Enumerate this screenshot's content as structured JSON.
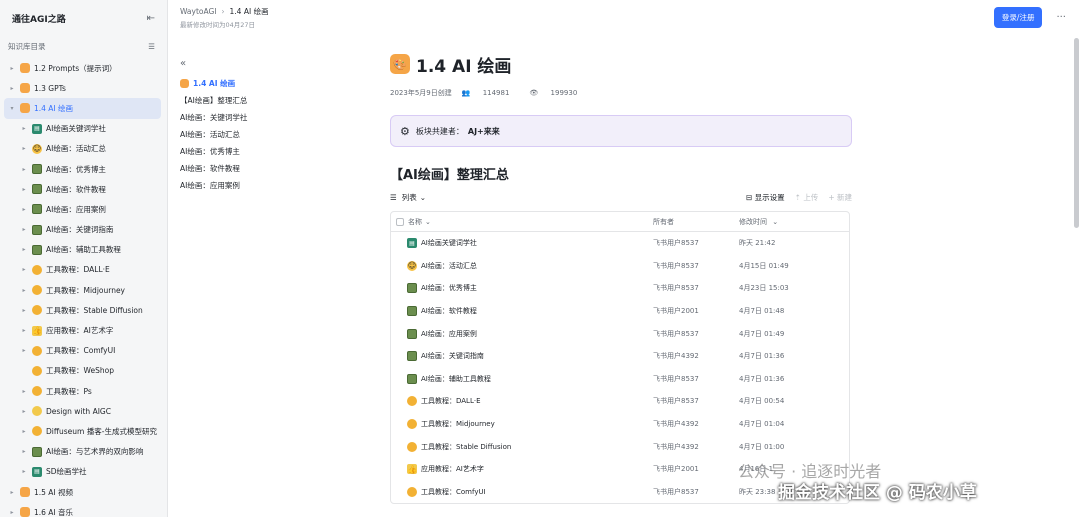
{
  "sidebar": {
    "title": "通往AGI之路",
    "section": "知识库目录",
    "items": [
      {
        "label": "1.2 Prompts（提示词）",
        "icon": "folder-icon",
        "level": 0
      },
      {
        "label": "1.3 GPTs",
        "icon": "folder-icon",
        "level": 0
      },
      {
        "label": "1.4 AI 绘画",
        "icon": "folder-icon",
        "level": 0,
        "active": true
      },
      {
        "label": "AI绘画关键词学社",
        "icon": "book-icon",
        "level": 1
      },
      {
        "label": "AI绘画：活动汇总",
        "icon": "face-icon",
        "level": 1
      },
      {
        "label": "AI绘画：优秀博主",
        "icon": "image-icon",
        "level": 1
      },
      {
        "label": "AI绘画：软件教程",
        "icon": "image-icon",
        "level": 1
      },
      {
        "label": "AI绘画：应用案例",
        "icon": "image-icon",
        "level": 1
      },
      {
        "label": "AI绘画：关键词指南",
        "icon": "image-icon",
        "level": 1
      },
      {
        "label": "AI绘画：辅助工具教程",
        "icon": "image-icon",
        "level": 1
      },
      {
        "label": "工具教程：DALL·E",
        "icon": "chat-icon",
        "level": 1
      },
      {
        "label": "工具教程：Midjourney",
        "icon": "chat-icon",
        "level": 1
      },
      {
        "label": "工具教程：Stable Diffusion",
        "icon": "chat-icon",
        "level": 1
      },
      {
        "label": "应用教程：AI艺术字",
        "icon": "thumb-icon",
        "level": 1
      },
      {
        "label": "工具教程：ComfyUI",
        "icon": "chat-icon",
        "level": 1
      },
      {
        "label": "工具教程：WeShop",
        "icon": "chat-icon",
        "level": 1,
        "noArrow": true
      },
      {
        "label": "工具教程：Ps",
        "icon": "chat-icon",
        "level": 1
      },
      {
        "label": "Design with AIGC",
        "icon": "bulb-icon",
        "level": 1
      },
      {
        "label": "Diffuseum 播客-生成式模型研究",
        "icon": "chat-icon",
        "level": 1
      },
      {
        "label": "AI绘画：与艺术界的双向影响",
        "icon": "image-icon",
        "level": 1
      },
      {
        "label": "SD绘画学社",
        "icon": "book-icon",
        "level": 1
      },
      {
        "label": "1.5 AI 视频",
        "icon": "folder-icon",
        "level": 0
      },
      {
        "label": "1.6 AI 音乐",
        "icon": "folder-icon",
        "level": 0
      }
    ]
  },
  "header": {
    "crumb_root": "WaytoAGI",
    "crumb_current": "1.4 AI 绘画",
    "updated": "最新修改时间为04月27日",
    "login_label": "登录/注册",
    "more": "···"
  },
  "toc": {
    "back": "«",
    "items": [
      {
        "label": "1.4 AI 绘画",
        "active": true
      },
      {
        "label": "【AI绘画】整理汇总"
      },
      {
        "label": "AI绘画：关键词学社"
      },
      {
        "label": "AI绘画：活动汇总"
      },
      {
        "label": "AI绘画：优秀博主"
      },
      {
        "label": "AI绘画：软件教程"
      },
      {
        "label": "AI绘画：应用案例"
      }
    ]
  },
  "doc": {
    "title": "1.4 AI 绘画",
    "created": "2023年5月9日创建",
    "viewers": "114981",
    "views": "199930",
    "callout_label": "板块共建者：",
    "callout_name": "AJ+来来",
    "section_title": "【AI绘画】整理汇总",
    "view_label": "列表",
    "toolbar": {
      "display": "显示设置",
      "upload": "上传",
      "new": "新建"
    },
    "table": {
      "headers": {
        "name": "名称",
        "owner": "所有者",
        "time": "修改时间"
      },
      "rows": [
        {
          "name": "AI绘画关键词学社",
          "icon": "book-icon",
          "owner": "飞书用户8537",
          "time": "昨天 21:42"
        },
        {
          "name": "AI绘画：活动汇总",
          "icon": "face-icon",
          "owner": "飞书用户8537",
          "time": "4月15日 01:49"
        },
        {
          "name": "AI绘画：优秀博主",
          "icon": "image-icon",
          "owner": "飞书用户8537",
          "time": "4月23日 15:03"
        },
        {
          "name": "AI绘画：软件教程",
          "icon": "image-icon",
          "owner": "飞书用户2001",
          "time": "4月7日 01:48"
        },
        {
          "name": "AI绘画：应用案例",
          "icon": "image-icon",
          "owner": "飞书用户8537",
          "time": "4月7日 01:49"
        },
        {
          "name": "AI绘画：关键词指南",
          "icon": "image-icon",
          "owner": "飞书用户4392",
          "time": "4月7日 01:36"
        },
        {
          "name": "AI绘画：辅助工具教程",
          "icon": "image-icon",
          "owner": "飞书用户8537",
          "time": "4月7日 01:36"
        },
        {
          "name": "工具教程：DALL·E",
          "icon": "chat-icon",
          "owner": "飞书用户8537",
          "time": "4月7日 00:54"
        },
        {
          "name": "工具教程：Midjourney",
          "icon": "chat-icon",
          "owner": "飞书用户4392",
          "time": "4月7日 01:04"
        },
        {
          "name": "工具教程：Stable Diffusion",
          "icon": "chat-icon",
          "owner": "飞书用户4392",
          "time": "4月7日 01:00"
        },
        {
          "name": "应用教程：AI艺术字",
          "icon": "thumb-icon",
          "owner": "飞书用户2001",
          "time": "4月16日 1"
        },
        {
          "name": "工具教程：ComfyUI",
          "icon": "chat-icon",
          "owner": "飞书用户8537",
          "time": "昨天 23:38"
        }
      ]
    }
  },
  "watermark": {
    "line1": "公众号 · 追逐时光者",
    "line2": "掘金技术社区 @ 码农小草"
  },
  "colors": {
    "accent": "#3370ff",
    "callout_bg": "#f2effa",
    "folder": "#f5a547"
  }
}
